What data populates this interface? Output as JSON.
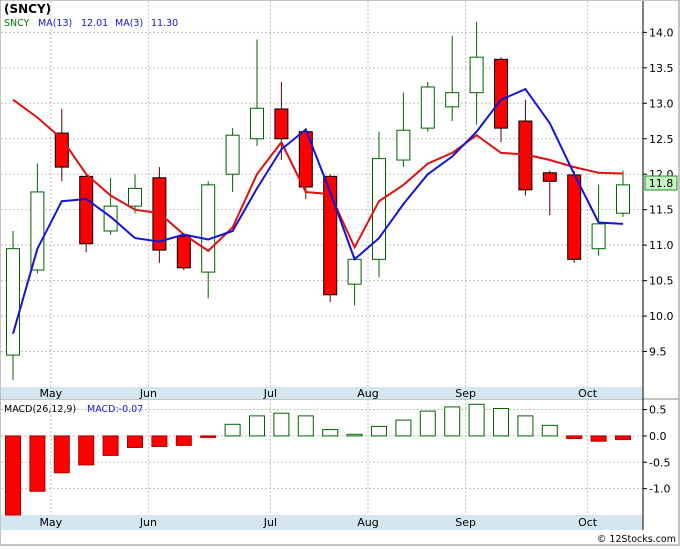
{
  "ticker_title": "(SNCY)",
  "legend": {
    "symbol": "SNCY",
    "ma_slow_label": "MA(13)",
    "ma_slow_value": "12.01",
    "ma_fast_label": "MA(3)",
    "ma_fast_value": "11.30"
  },
  "price_badge": "11.8",
  "macd_legend": {
    "label": "MACD(26,12,9)",
    "value_text": "MACD:-0.07"
  },
  "credit": "© 12Stocks.com",
  "colors": {
    "up_candle": "#006400",
    "down_candle": "#ff0000",
    "ma_slow": "#e01010",
    "ma_fast": "#1414d6",
    "axis_band": "#d4e6f0",
    "grid": "#c0c0c0"
  },
  "chart_data": [
    {
      "type": "candlestick",
      "ylim": [
        9.0,
        14.4
      ],
      "y_ticks": [
        "9.5",
        "10.0",
        "10.5",
        "11.0",
        "11.5",
        "12.0",
        "12.5",
        "13.0",
        "13.5",
        "14.0"
      ],
      "x_ticks": [
        {
          "label": "May",
          "index": 1
        },
        {
          "label": "Jun",
          "index": 5
        },
        {
          "label": "Jul",
          "index": 10
        },
        {
          "label": "Aug",
          "index": 14
        },
        {
          "label": "Sep",
          "index": 18
        },
        {
          "label": "Oct",
          "index": 23
        }
      ],
      "candles": [
        {
          "open": 9.45,
          "high": 11.2,
          "low": 9.1,
          "close": 10.95
        },
        {
          "open": 10.65,
          "high": 12.15,
          "low": 10.6,
          "close": 11.75
        },
        {
          "open": 12.58,
          "high": 12.92,
          "low": 11.9,
          "close": 12.1
        },
        {
          "open": 11.97,
          "high": 12.0,
          "low": 10.9,
          "close": 11.02
        },
        {
          "open": 11.2,
          "high": 11.95,
          "low": 11.15,
          "close": 11.55
        },
        {
          "open": 11.55,
          "high": 12.0,
          "low": 11.45,
          "close": 11.8
        },
        {
          "open": 11.95,
          "high": 12.1,
          "low": 10.75,
          "close": 10.93
        },
        {
          "open": 11.12,
          "high": 11.15,
          "low": 10.65,
          "close": 10.68
        },
        {
          "open": 10.62,
          "high": 11.9,
          "low": 10.25,
          "close": 11.85
        },
        {
          "open": 12.0,
          "high": 12.65,
          "low": 11.75,
          "close": 12.55
        },
        {
          "open": 12.5,
          "high": 13.9,
          "low": 12.4,
          "close": 12.93
        },
        {
          "open": 12.92,
          "high": 13.3,
          "low": 12.2,
          "close": 12.5
        },
        {
          "open": 12.6,
          "high": 12.65,
          "low": 11.65,
          "close": 11.82
        },
        {
          "open": 11.97,
          "high": 12.0,
          "low": 10.2,
          "close": 10.3
        },
        {
          "open": 10.45,
          "high": 10.85,
          "low": 10.15,
          "close": 10.8
        },
        {
          "open": 10.8,
          "high": 12.6,
          "low": 10.55,
          "close": 12.22
        },
        {
          "open": 12.2,
          "high": 13.15,
          "low": 12.1,
          "close": 12.62
        },
        {
          "open": 12.65,
          "high": 13.3,
          "low": 12.6,
          "close": 13.23
        },
        {
          "open": 12.95,
          "high": 13.95,
          "low": 12.75,
          "close": 13.15
        },
        {
          "open": 13.15,
          "high": 14.15,
          "low": 12.7,
          "close": 13.65
        },
        {
          "open": 13.62,
          "high": 13.65,
          "low": 12.45,
          "close": 12.65
        },
        {
          "open": 12.75,
          "high": 13.05,
          "low": 11.7,
          "close": 11.78
        },
        {
          "open": 12.02,
          "high": 12.05,
          "low": 11.42,
          "close": 11.9
        },
        {
          "open": 11.99,
          "high": 12.05,
          "low": 10.75,
          "close": 10.8
        },
        {
          "open": 10.95,
          "high": 11.85,
          "low": 10.85,
          "close": 11.3
        },
        {
          "open": 11.45,
          "high": 12.05,
          "low": 11.4,
          "close": 11.85
        }
      ],
      "ma_slow": [
        13.05,
        12.8,
        12.5,
        12.0,
        11.7,
        11.5,
        11.45,
        11.15,
        10.92,
        11.25,
        12.0,
        12.45,
        11.75,
        11.72,
        10.97,
        11.62,
        11.85,
        12.15,
        12.3,
        12.55,
        12.3,
        12.28,
        12.2,
        12.1,
        12.02,
        12.01
      ],
      "ma_fast": [
        9.75,
        10.95,
        11.62,
        11.65,
        11.4,
        11.1,
        11.05,
        11.15,
        11.08,
        11.2,
        11.8,
        12.35,
        12.63,
        11.75,
        10.8,
        11.1,
        11.58,
        12.0,
        12.25,
        12.6,
        13.05,
        13.2,
        12.72,
        12.0,
        11.32,
        11.3
      ]
    },
    {
      "type": "bar",
      "ylim": [
        -1.5,
        0.7
      ],
      "y_ticks": [
        "0.5",
        "0.0",
        "-0.5",
        "-1.0"
      ],
      "values": [
        -1.5,
        -1.05,
        -0.7,
        -0.55,
        -0.37,
        -0.22,
        -0.2,
        -0.18,
        -0.02,
        0.22,
        0.38,
        0.43,
        0.38,
        0.12,
        0.03,
        0.18,
        0.3,
        0.47,
        0.55,
        0.6,
        0.52,
        0.38,
        0.2,
        -0.05,
        -0.1,
        -0.07
      ]
    }
  ]
}
